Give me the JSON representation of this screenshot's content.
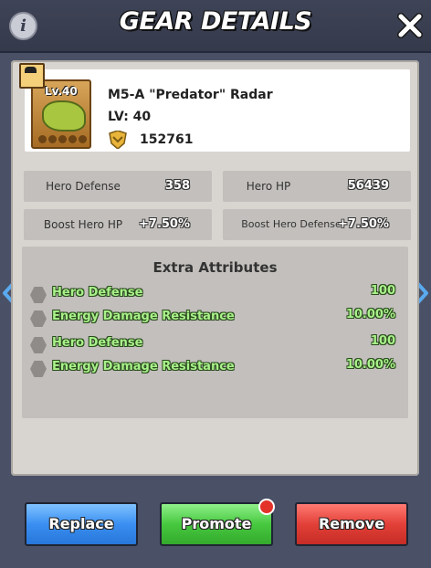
{
  "header": {
    "title": "GEAR DETAILS",
    "info_icon": "info-icon",
    "close_icon": "close-icon"
  },
  "item": {
    "level_badge": "Lv.40",
    "name": "M5-A \"Predator\" Radar",
    "level": "LV: 40",
    "power": "152761"
  },
  "stats": [
    {
      "label": "Hero Defense",
      "value": "358"
    },
    {
      "label": "Hero HP",
      "value": "56439"
    },
    {
      "label": "Boost Hero HP",
      "value": "+7.50%"
    },
    {
      "label": "Boost Hero Defense",
      "value": "+7.50%"
    }
  ],
  "extra": {
    "title": "Extra Attributes",
    "attributes": [
      {
        "name": "Hero Defense",
        "value": "100"
      },
      {
        "name": "Energy Damage Resistance",
        "value": "10.00%"
      },
      {
        "name": "Hero Defense",
        "value": "100"
      },
      {
        "name": "Energy Damage Resistance",
        "value": "10.00%"
      }
    ]
  },
  "buttons": {
    "replace": "Replace",
    "promote": "Promote",
    "remove": "Remove"
  },
  "colors": {
    "replace": "#3b8ff2",
    "promote": "#47c83f",
    "remove": "#e24038",
    "attribute_text": "#a9f28a"
  }
}
